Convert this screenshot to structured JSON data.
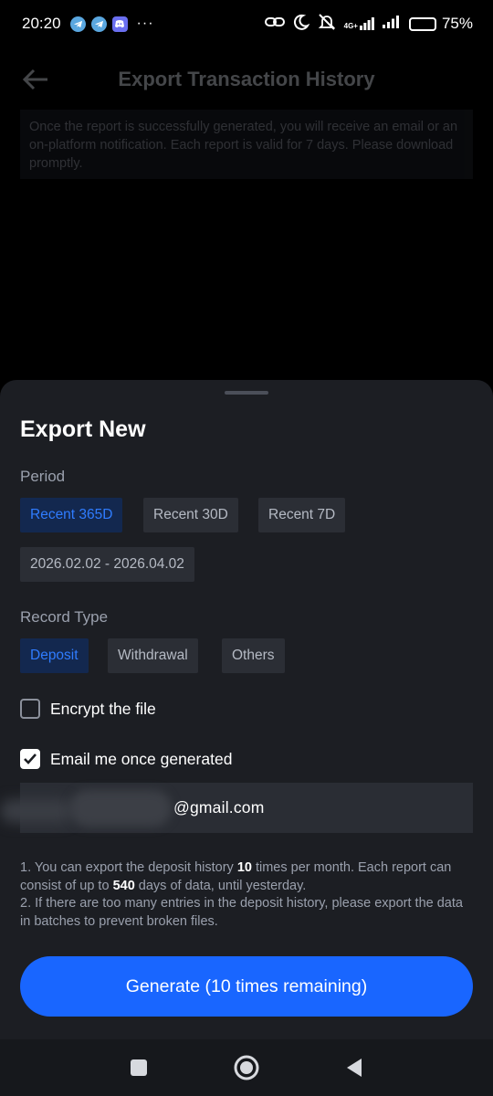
{
  "status_bar": {
    "time": "20:20",
    "app_icons": [
      "telegram-icon",
      "telegram-icon",
      "discord-icon"
    ],
    "overflow": "···",
    "network_label": "4G+",
    "battery_percent": "75%",
    "battery_level": 0.75
  },
  "page": {
    "title": "Export Transaction History",
    "notice": "Once the report is successfully generated, you will receive an email or an on-platform notification. Each report is valid for 7 days. Please download promptly."
  },
  "sheet": {
    "title": "Export New",
    "period": {
      "label": "Period",
      "options": [
        "Recent 365D",
        "Recent 30D",
        "Recent 7D"
      ],
      "selected": "Recent 365D",
      "custom_range": "2026.02.02 - 2026.04.02"
    },
    "record_type": {
      "label": "Record Type",
      "options": [
        "Deposit",
        "Withdrawal",
        "Others"
      ],
      "selected": "Deposit"
    },
    "encrypt": {
      "label": "Encrypt the file",
      "checked": false
    },
    "email_notify": {
      "label": "Email me once generated",
      "checked": true
    },
    "email_value": "@gmail.com",
    "notes": {
      "line1_a": "1. You can export the deposit history ",
      "line1_times": "10",
      "line1_b": " times per month. Each report can consist of up to ",
      "line1_days": "540",
      "line1_c": " days of data, until yesterday.",
      "line2": "2. If there are too many entries in the deposit history, please export the data in batches to prevent broken files."
    },
    "generate_label": "Generate (10 times remaining)",
    "accent_color": "#1966ff",
    "selected_chip_text_color": "#2f7cff"
  }
}
